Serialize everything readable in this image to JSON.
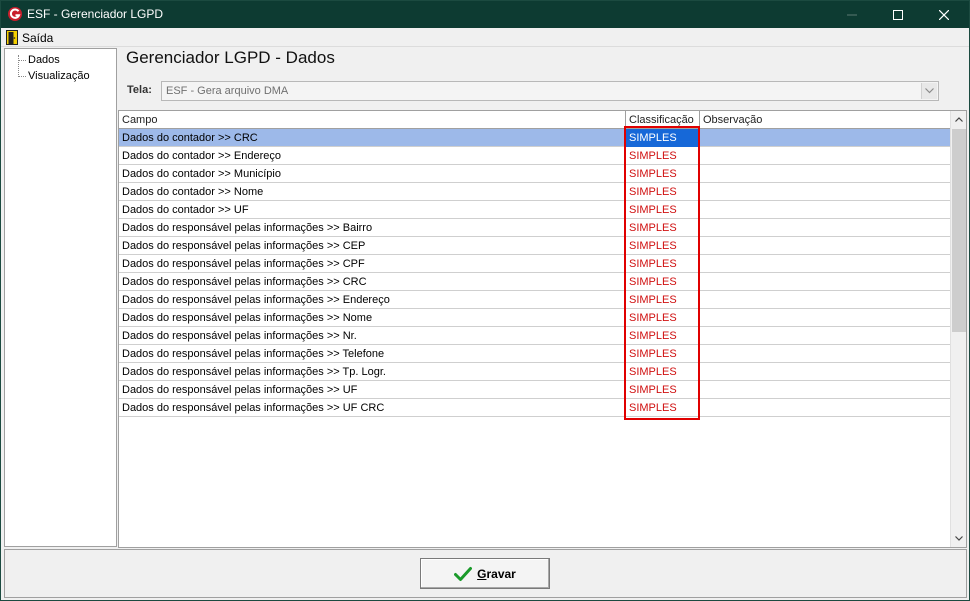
{
  "window": {
    "title": "ESF - Gerenciador LGPD"
  },
  "menu": {
    "items": [
      {
        "label": "Saída",
        "icon": "exit-door-icon"
      }
    ]
  },
  "tree": {
    "items": [
      {
        "label": "Dados"
      },
      {
        "label": "Visualização"
      }
    ]
  },
  "main": {
    "title": "Gerenciador LGPD - Dados",
    "tela_label": "Tela:",
    "tela_value": "ESF - Gera arquivo DMA"
  },
  "grid": {
    "columns": [
      "Campo",
      "Classificação",
      "Observação"
    ],
    "rows": [
      {
        "campo": "Dados do contador >> CRC",
        "classificacao": "SIMPLES",
        "observacao": ""
      },
      {
        "campo": "Dados do contador >> Endereço",
        "classificacao": "SIMPLES",
        "observacao": ""
      },
      {
        "campo": "Dados do contador >> Município",
        "classificacao": "SIMPLES",
        "observacao": ""
      },
      {
        "campo": "Dados do contador >> Nome",
        "classificacao": "SIMPLES",
        "observacao": ""
      },
      {
        "campo": "Dados do contador >> UF",
        "classificacao": "SIMPLES",
        "observacao": ""
      },
      {
        "campo": "Dados do responsável pelas informações >> Bairro",
        "classificacao": "SIMPLES",
        "observacao": ""
      },
      {
        "campo": "Dados do responsável pelas informações >> CEP",
        "classificacao": "SIMPLES",
        "observacao": ""
      },
      {
        "campo": "Dados do responsável pelas informações >> CPF",
        "classificacao": "SIMPLES",
        "observacao": ""
      },
      {
        "campo": "Dados do responsável pelas informações >> CRC",
        "classificacao": "SIMPLES",
        "observacao": ""
      },
      {
        "campo": "Dados do responsável pelas informações >> Endereço",
        "classificacao": "SIMPLES",
        "observacao": ""
      },
      {
        "campo": "Dados do responsável pelas informações >> Nome",
        "classificacao": "SIMPLES",
        "observacao": ""
      },
      {
        "campo": "Dados do responsável pelas informações >> Nr.",
        "classificacao": "SIMPLES",
        "observacao": ""
      },
      {
        "campo": "Dados do responsável pelas informações >> Telefone",
        "classificacao": "SIMPLES",
        "observacao": ""
      },
      {
        "campo": "Dados do responsável pelas informações >> Tp. Logr.",
        "classificacao": "SIMPLES",
        "observacao": ""
      },
      {
        "campo": "Dados do responsável pelas informações >> UF",
        "classificacao": "SIMPLES",
        "observacao": ""
      },
      {
        "campo": "Dados do responsável pelas informações >> UF CRC",
        "classificacao": "SIMPLES",
        "observacao": ""
      }
    ],
    "selected_row": 0
  },
  "footer": {
    "save_label_first": "G",
    "save_label_rest": "ravar"
  },
  "colors": {
    "titlebar": "#0d3b32",
    "selected_row": "#9db9e9",
    "selected_cell": "#1668d8",
    "classification_text": "#d01010",
    "highlight_border": "#e00000"
  }
}
